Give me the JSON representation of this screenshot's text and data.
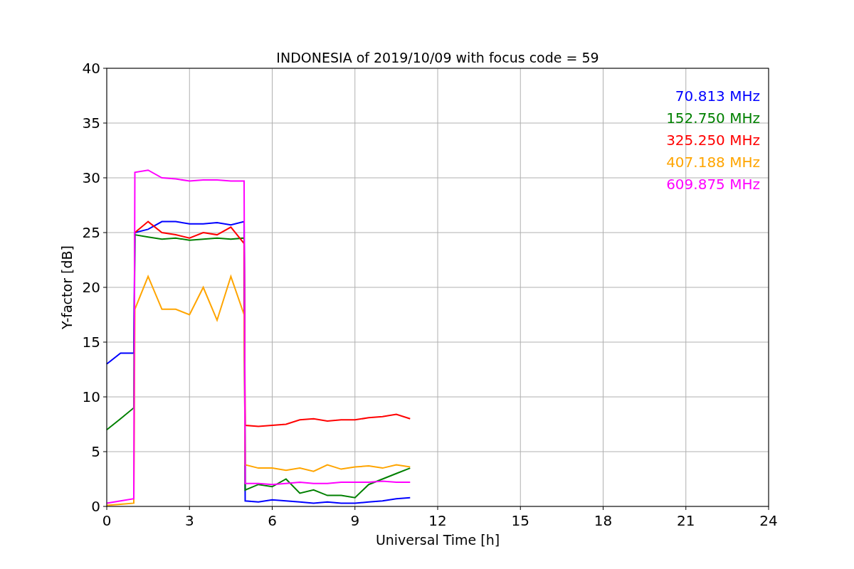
{
  "plot": {
    "chart_data": {
      "type": "line",
      "title": "INDONESIA of 2019/10/09 with focus code = 59",
      "xlabel": "Universal Time [h]",
      "ylabel": "Y-factor [dB]",
      "x": [
        0,
        0.5,
        0.98,
        1.02,
        1.5,
        2,
        2.5,
        3,
        3.5,
        4,
        4.5,
        4.98,
        5.02,
        5.5,
        6,
        6.5,
        7,
        7.5,
        8,
        8.5,
        9,
        9.5,
        10,
        10.5,
        11
      ],
      "series": [
        {
          "name": "70.813 MHz",
          "color": "#0000ff",
          "values": [
            13,
            14,
            14,
            25,
            25.3,
            26,
            26,
            25.8,
            25.8,
            25.9,
            25.7,
            26,
            0.5,
            0.4,
            0.6,
            0.5,
            0.4,
            0.3,
            0.4,
            0.3,
            0.3,
            0.4,
            0.5,
            0.7,
            0.8
          ]
        },
        {
          "name": "152.750 MHz",
          "color": "#008000",
          "values": [
            7,
            8,
            9,
            24.8,
            24.6,
            24.4,
            24.5,
            24.3,
            24.4,
            24.5,
            24.4,
            24.5,
            1.5,
            2,
            1.8,
            2.5,
            1.2,
            1.5,
            1,
            1,
            0.8,
            2,
            2.5,
            3,
            3.5
          ]
        },
        {
          "name": "325.250 MHz",
          "color": "#ff0000",
          "values": [
            null,
            null,
            null,
            25,
            26,
            25,
            24.8,
            24.5,
            25,
            24.8,
            25.5,
            24,
            7.4,
            7.3,
            7.4,
            7.5,
            7.9,
            8,
            7.8,
            7.9,
            7.9,
            8.1,
            8.2,
            8.4,
            8.0
          ]
        },
        {
          "name": "407.188 MHz",
          "color": "#ffa500",
          "values": [
            0.1,
            0.2,
            0.3,
            18,
            21,
            18,
            18,
            17.5,
            20,
            17,
            21,
            17.5,
            3.8,
            3.5,
            3.5,
            3.3,
            3.5,
            3.2,
            3.8,
            3.4,
            3.6,
            3.7,
            3.5,
            3.8,
            3.6
          ]
        },
        {
          "name": "609.875 MHz",
          "color": "#ff00ff",
          "values": [
            0.3,
            0.5,
            0.7,
            30.5,
            30.7,
            30,
            29.9,
            29.7,
            29.8,
            29.8,
            29.7,
            29.7,
            2.1,
            2.1,
            2.0,
            2.1,
            2.2,
            2.1,
            2.1,
            2.2,
            2.2,
            2.2,
            2.3,
            2.2,
            2.2
          ]
        }
      ],
      "grid": true,
      "xlim": [
        0,
        24
      ],
      "ylim": [
        0,
        40
      ],
      "xticks": [
        0,
        3,
        6,
        9,
        12,
        15,
        18,
        21,
        24
      ],
      "yticks": [
        0,
        5,
        10,
        15,
        20,
        25,
        30,
        35,
        40
      ]
    }
  }
}
